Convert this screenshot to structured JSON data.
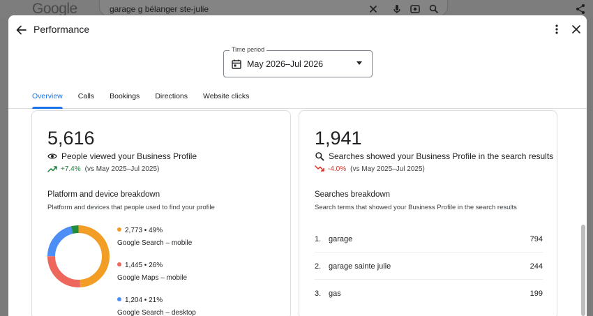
{
  "background": {
    "logo": "Google",
    "search_query": "garage g bélanger ste-julie",
    "icons": [
      "close-icon",
      "mic-icon",
      "lens-icon",
      "search-icon",
      "share-icon"
    ]
  },
  "dialog": {
    "title": "Performance",
    "time_period": {
      "label": "Time period",
      "value": "May 2026–Jul 2026"
    },
    "tabs": [
      {
        "label": "Overview",
        "active": true
      },
      {
        "label": "Calls",
        "active": false
      },
      {
        "label": "Bookings",
        "active": false
      },
      {
        "label": "Directions",
        "active": false
      },
      {
        "label": "Website clicks",
        "active": false
      }
    ]
  },
  "views_card": {
    "total": "5,616",
    "metric_label": "People viewed your Business Profile",
    "change": "+7.4%",
    "comparison": "(vs May 2025–Jul 2025)",
    "section_title": "Platform and device breakdown",
    "section_subtitle": "Platform and devices that people used to find your profile",
    "breakdown": [
      {
        "value": "2,773",
        "percent": "49%",
        "label": "Google Search – mobile",
        "color": "#f29e26",
        "share": 0.49
      },
      {
        "value": "1,445",
        "percent": "26%",
        "label": "Google Maps – mobile",
        "color": "#ee675c",
        "share": 0.26
      },
      {
        "value": "1,204",
        "percent": "21%",
        "label": "Google Search – desktop",
        "color": "#4c8df6",
        "share": 0.21
      }
    ],
    "donut_other": {
      "color": "#1e8e3e",
      "share": 0.04
    }
  },
  "searches_card": {
    "total": "1,941",
    "metric_label": "Searches showed your Business Profile in the search results",
    "change": "-4.0%",
    "comparison": "(vs May 2025–Jul 2025)",
    "section_title": "Searches breakdown",
    "section_subtitle": "Search terms that showed your Business Profile in the search results",
    "terms": [
      {
        "rank": "1.",
        "term": "garage",
        "count": "794"
      },
      {
        "rank": "2.",
        "term": "garage sainte julie",
        "count": "244"
      },
      {
        "rank": "3.",
        "term": "gas",
        "count": "199"
      }
    ]
  },
  "colors": {
    "accent": "#1a73e8",
    "positive": "#188038",
    "negative": "#d93025"
  }
}
